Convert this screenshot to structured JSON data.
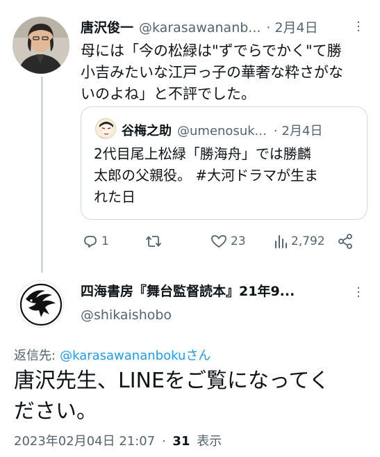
{
  "parent": {
    "display_name": "唐沢俊一",
    "handle": "@karasawananb...",
    "separator": "·",
    "date": "2月4日",
    "text_lines": [
      "母には「今の松緑は\"ずでらでかく\"て勝",
      "小吉みたいな江戸っ子の華奢な粋さがな",
      "いのよね」と不評でした。"
    ],
    "quote": {
      "display_name": "谷梅之助",
      "handle": "@umenosuk...",
      "separator": "·",
      "date": "2月4日",
      "text_lines": [
        "2代目尾上松緑「勝海舟」では勝麟",
        "太郎の父親役。 #大河ドラマが生ま",
        "れた日"
      ]
    },
    "actions": {
      "reply_count": "1",
      "retweet_count": "",
      "like_count": "23",
      "view_count": "2,792"
    }
  },
  "reply": {
    "display_name": "四海書房『舞台監督読本』21年9...",
    "handle": "@shikaishobo",
    "replying_to_label": "返信先:",
    "replying_to_handle": "@karasawananboku",
    "replying_to_suffix": "さん",
    "text_lines": [
      "唐沢先生、LINEをご覧になってく",
      "ださい。"
    ],
    "timestamp": "2023年02月04日 21:07",
    "separator": "·",
    "views_count": "31",
    "views_label": "表示"
  },
  "colors": {
    "text": "#0f1419",
    "muted": "#536471",
    "link": "#1d9bf0",
    "border": "#cfd9de"
  }
}
